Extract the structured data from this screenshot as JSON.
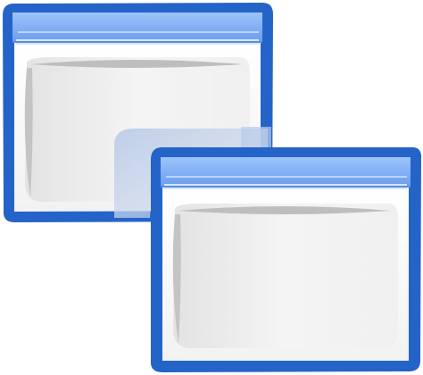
{
  "icon": {
    "name": "windows-icon",
    "windows": [
      {
        "name": "back-window"
      },
      {
        "name": "front-window"
      }
    ]
  },
  "colors": {
    "frame_blue": "#1F5FC4",
    "frame_blue_light": "#3B7AD8",
    "title_bar_top": "#8DB9F8",
    "title_bar_bottom": "#6FA0F0",
    "title_bar_highlight": "#D8E8FF",
    "window_body": "#FBFBFB",
    "inner_panel": "#EFEFEF",
    "inner_shadow": "#BDBDBD",
    "overlap_shadow": "#C8D3E6"
  }
}
